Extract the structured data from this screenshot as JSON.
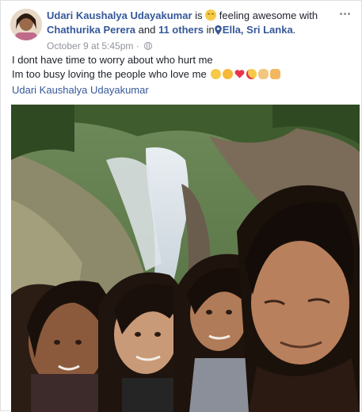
{
  "post": {
    "author": "Udari Kaushalya Udayakumar",
    "is_text": "is",
    "feeling_text": "feeling awesome with",
    "tagged_user": "Chathurika Perera",
    "and_text": "and",
    "others_text": "11 others",
    "in_text": "in",
    "location": "Ella, Sri Lanka",
    "period": ".",
    "timestamp": "October 9 at 5:45pm",
    "separator": "·",
    "body_line1": "I dont have time to worry about who hurt me",
    "body_line2": "Im too busy loving the people who love me",
    "mention": "Udari Kaushalya Udayakumar",
    "icons": {
      "feeling": "smiling-face-icon",
      "location": "location-pin-icon",
      "privacy": "globe-icon",
      "more": "more-options-icon"
    },
    "emojis": [
      "kiss-face-icon",
      "smiling-face-icon",
      "red-heart-icon",
      "heart-eyes-icon",
      "ok-hand-icon",
      "thumbs-up-icon"
    ]
  },
  "colors": {
    "link": "#365899",
    "meta": "#90949c",
    "text": "#1d2129"
  }
}
